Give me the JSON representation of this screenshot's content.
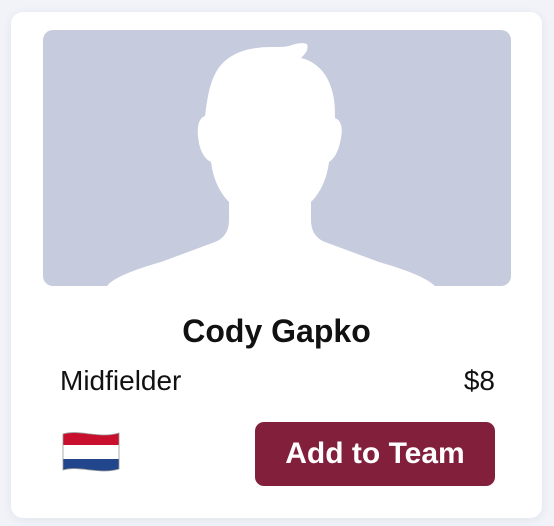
{
  "player": {
    "name": "Cody Gapko",
    "position": "Midfielder",
    "price": "$8",
    "nationality_flag_icon": "netherlands-flag-icon",
    "photo_icon": "placeholder-avatar-icon"
  },
  "actions": {
    "add_label": "Add to Team"
  },
  "colors": {
    "page_background": "#f1f3f9",
    "card_background": "#ffffff",
    "photo_background": "#c6ccdd",
    "silhouette": "#ffffff",
    "button_background": "#82203c",
    "button_text": "#ffffff",
    "flag_red": "#c8102e",
    "flag_white": "#ffffff",
    "flag_blue": "#21468b"
  }
}
